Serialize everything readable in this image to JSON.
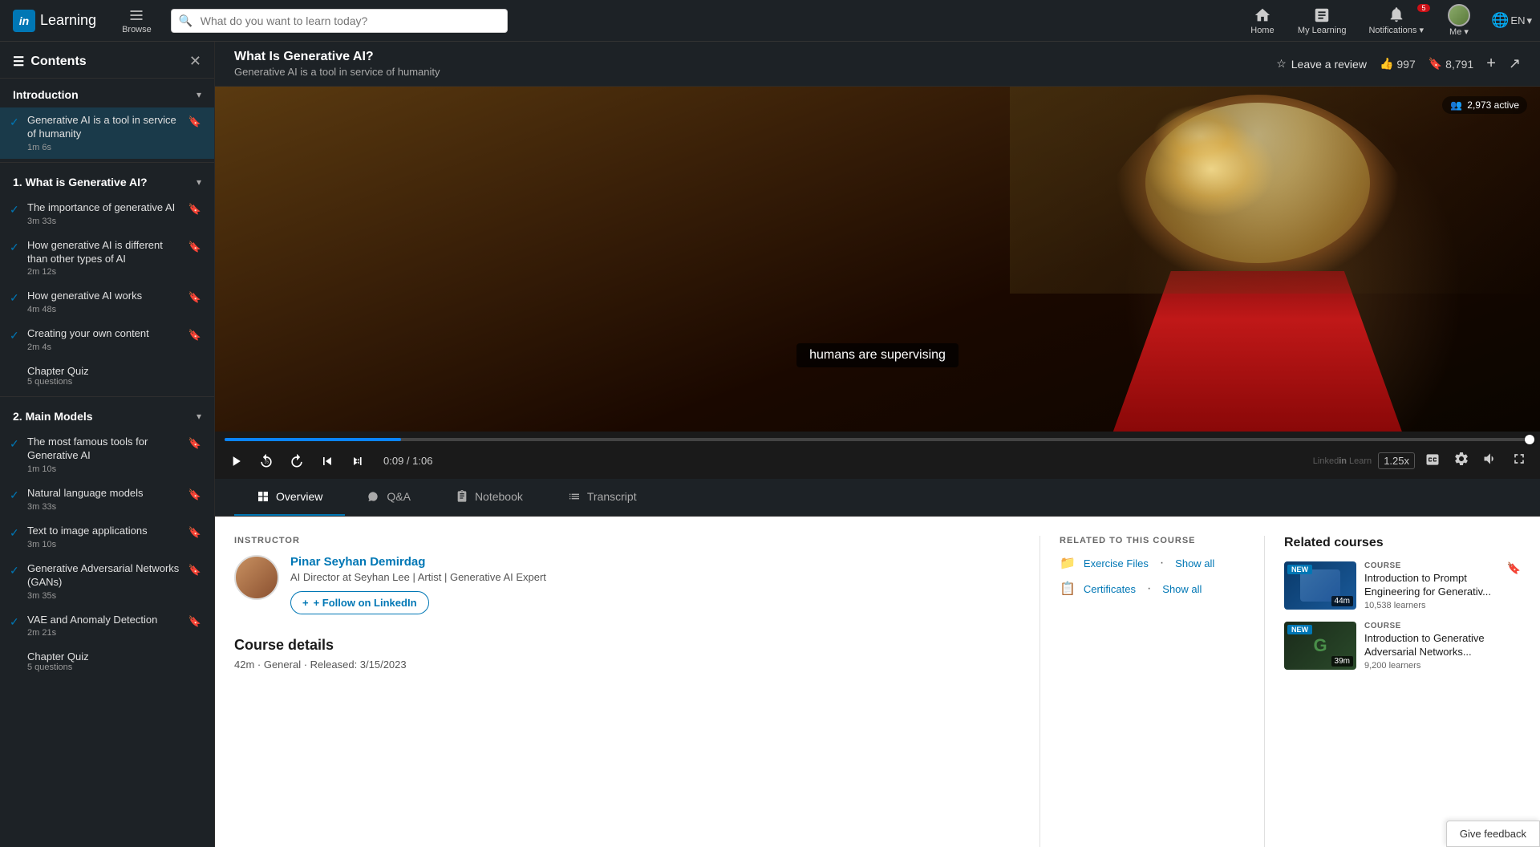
{
  "topnav": {
    "logo_in": "in",
    "brand": "Learning",
    "browse_label": "Browse",
    "search_placeholder": "What do you want to learn today?",
    "home_label": "Home",
    "my_learning_label": "My Learning",
    "notifications_label": "Notifications",
    "notifications_caret": "▾",
    "me_label": "Me",
    "me_caret": "▾",
    "lang_label": "EN",
    "lang_caret": "▾",
    "notif_badge": "5"
  },
  "sidebar": {
    "title": "Contents",
    "sections": [
      {
        "id": "intro",
        "title": "Introduction",
        "expanded": true,
        "lessons": [
          {
            "title": "Generative AI is a tool in service of humanity",
            "duration": "1m 6s",
            "completed": true,
            "active": true
          }
        ]
      },
      {
        "id": "ch1",
        "title": "1. What is Generative AI?",
        "expanded": true,
        "lessons": [
          {
            "title": "The importance of generative AI",
            "duration": "3m 33s",
            "completed": true
          },
          {
            "title": "How generative AI is different than other types of AI",
            "duration": "2m 12s",
            "completed": true
          },
          {
            "title": "How generative AI works",
            "duration": "4m 48s",
            "completed": true
          },
          {
            "title": "Creating your own content",
            "duration": "2m 4s",
            "completed": true
          },
          {
            "title": "Chapter Quiz",
            "duration": "5 questions",
            "quiz": true
          }
        ]
      },
      {
        "id": "ch2",
        "title": "2. Main Models",
        "expanded": true,
        "lessons": [
          {
            "title": "The most famous tools for Generative AI",
            "duration": "1m 10s",
            "completed": true
          },
          {
            "title": "Natural language models",
            "duration": "3m 33s",
            "completed": true
          },
          {
            "title": "Text to image applications",
            "duration": "3m 10s",
            "completed": true
          },
          {
            "title": "Generative Adversarial Networks (GANs)",
            "duration": "3m 35s",
            "completed": true
          },
          {
            "title": "VAE and Anomaly Detection",
            "duration": "2m 21s",
            "completed": true
          },
          {
            "title": "Chapter Quiz",
            "duration": "5 questions",
            "quiz": true
          }
        ]
      }
    ]
  },
  "video_header": {
    "title": "What Is Generative AI?",
    "subtitle": "Generative AI is a tool in service of humanity",
    "leave_review": "Leave a review",
    "like_count": "997",
    "bookmark_count": "8,791",
    "add_icon": "+",
    "share_icon": "↗"
  },
  "video_player": {
    "subtitle_text": "humans are supervising",
    "active_viewers": "2,973 active",
    "current_time": "0:09",
    "total_time": "1:06",
    "time_display": "0:09 / 1:06",
    "speed": "1.25x",
    "watermark": "Linked in Learn"
  },
  "tabs": [
    {
      "id": "overview",
      "label": "Overview",
      "active": true,
      "icon": "grid"
    },
    {
      "id": "qa",
      "label": "Q&A",
      "active": false,
      "icon": "message"
    },
    {
      "id": "notebook",
      "label": "Notebook",
      "active": false,
      "icon": "book"
    },
    {
      "id": "transcript",
      "label": "Transcript",
      "active": false,
      "icon": "list"
    }
  ],
  "instructor": {
    "label": "INSTRUCTOR",
    "name": "Pinar Seyhan Demirdag",
    "title": "AI Director at Seyhan Lee | Artist | Generative AI Expert",
    "follow_label": "+ Follow on LinkedIn"
  },
  "related_course": {
    "label": "RELATED TO THIS COURSE",
    "exercise_files": "Exercise Files",
    "exercise_show": "Show all",
    "certificates": "Certificates",
    "cert_show": "Show all"
  },
  "related_courses": {
    "title": "Related courses",
    "courses": [
      {
        "type": "COURSE",
        "name": "Introduction to Prompt Engineering for Generativ...",
        "learners": "10,538 learners",
        "duration": "44m",
        "new_badge": "NEW"
      },
      {
        "type": "COURSE",
        "name": "Introduction to Generative Adversarial Networks...",
        "learners": "9,200 learners",
        "duration": "39m",
        "new_badge": "NEW"
      }
    ]
  },
  "course_details": {
    "title": "Course details",
    "meta": "42m · General · Released: 3/15/2023"
  },
  "give_feedback": {
    "label": "Give feedback"
  }
}
